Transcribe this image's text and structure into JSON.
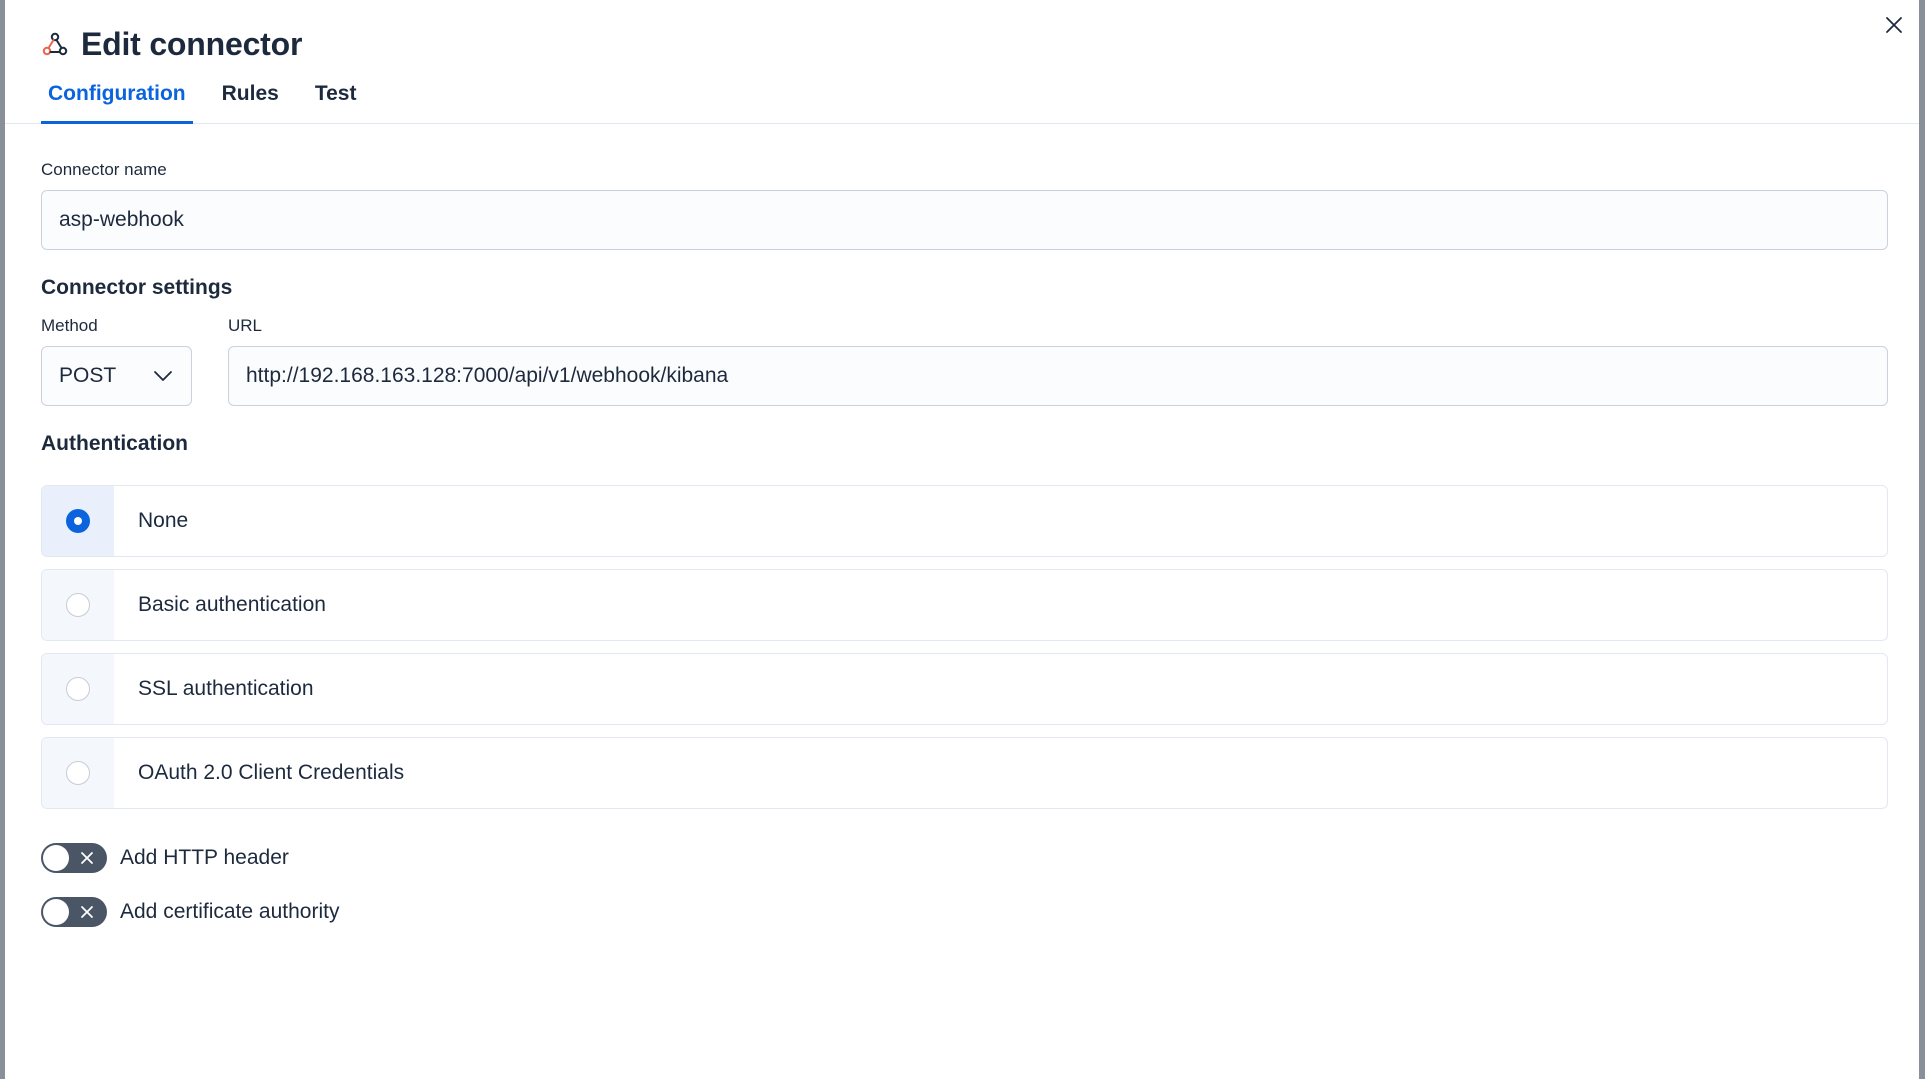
{
  "flyout": {
    "title": "Edit connector",
    "close_icon": "close-icon",
    "title_icon": "webhook-icon",
    "tabs": [
      {
        "label": "Configuration",
        "active": true
      },
      {
        "label": "Rules",
        "active": false
      },
      {
        "label": "Test",
        "active": false
      }
    ]
  },
  "form": {
    "connector_name_label": "Connector name",
    "connector_name_value": "asp-webhook",
    "connector_settings_title": "Connector settings",
    "method_label": "Method",
    "method_value": "POST",
    "url_label": "URL",
    "url_value": "http://192.168.163.128:7000/api/v1/webhook/kibana",
    "authentication_title": "Authentication",
    "auth_options": [
      {
        "label": "None",
        "selected": true
      },
      {
        "label": "Basic authentication",
        "selected": false
      },
      {
        "label": "SSL authentication",
        "selected": false
      },
      {
        "label": "OAuth 2.0 Client Credentials",
        "selected": false
      }
    ],
    "toggles": [
      {
        "label": "Add HTTP header",
        "on": false
      },
      {
        "label": "Add certificate authority",
        "on": false
      }
    ]
  },
  "colors": {
    "accent": "#0b64dd",
    "text": "#1d2a3e",
    "switch_off": "#4a5566",
    "overlay": "#8a8f99"
  }
}
